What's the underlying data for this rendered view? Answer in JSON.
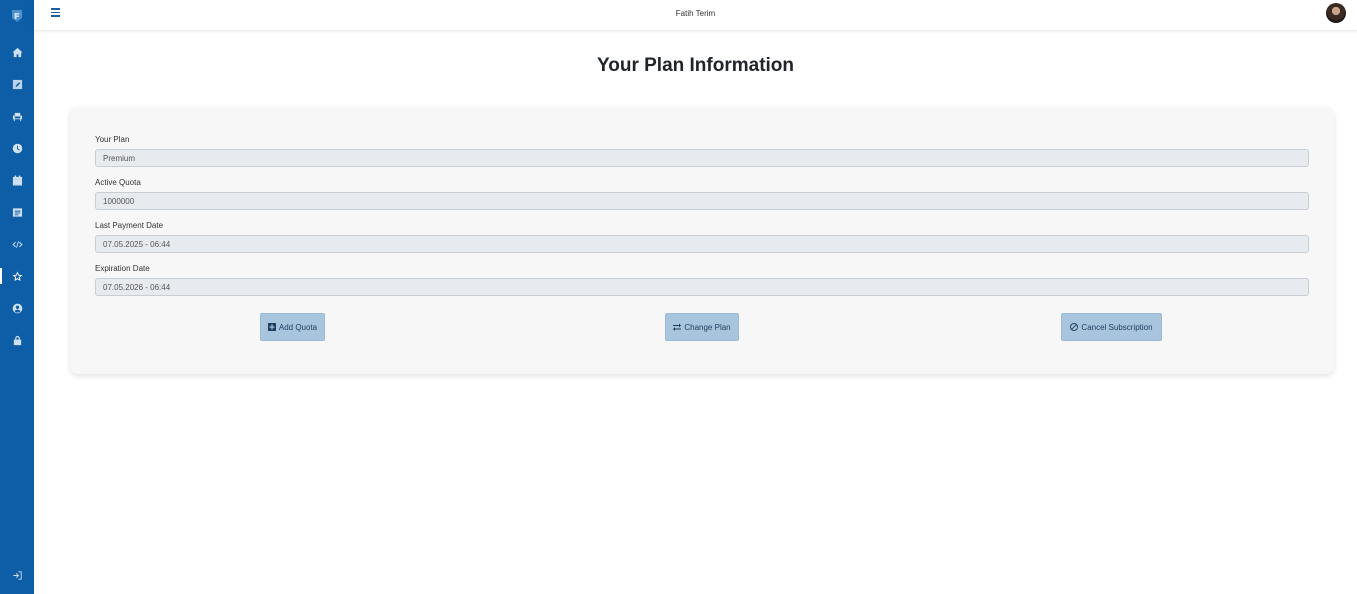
{
  "header": {
    "user_name": "Fatih Terim"
  },
  "sidebar": {
    "items": [
      {
        "icon": "home-icon"
      },
      {
        "icon": "edit-icon"
      },
      {
        "icon": "couch-icon"
      },
      {
        "icon": "clock-icon"
      },
      {
        "icon": "calendar-icon"
      },
      {
        "icon": "list-icon"
      },
      {
        "icon": "code-icon"
      },
      {
        "icon": "star-icon",
        "active": true
      },
      {
        "icon": "user-circle-icon"
      },
      {
        "icon": "lock-icon"
      }
    ],
    "bottom_icon": "sign-out-icon"
  },
  "page": {
    "title": "Your Plan Information"
  },
  "plan": {
    "your_plan_label": "Your Plan",
    "your_plan_value": "Premium",
    "active_quota_label": "Active Quota",
    "active_quota_value": "1000000",
    "last_payment_label": "Last Payment Date",
    "last_payment_value": "07.05.2025 - 06:44",
    "expiration_label": "Expiration Date",
    "expiration_value": "07.05.2026 - 06:44"
  },
  "actions": {
    "add_quota": "Add Quota",
    "change_plan": "Change Plan",
    "cancel_subscription": "Cancel Subscription"
  },
  "colors": {
    "sidebar": "#0d5ea6",
    "button": "#a9c5dd",
    "card": "#f7f7f7"
  }
}
